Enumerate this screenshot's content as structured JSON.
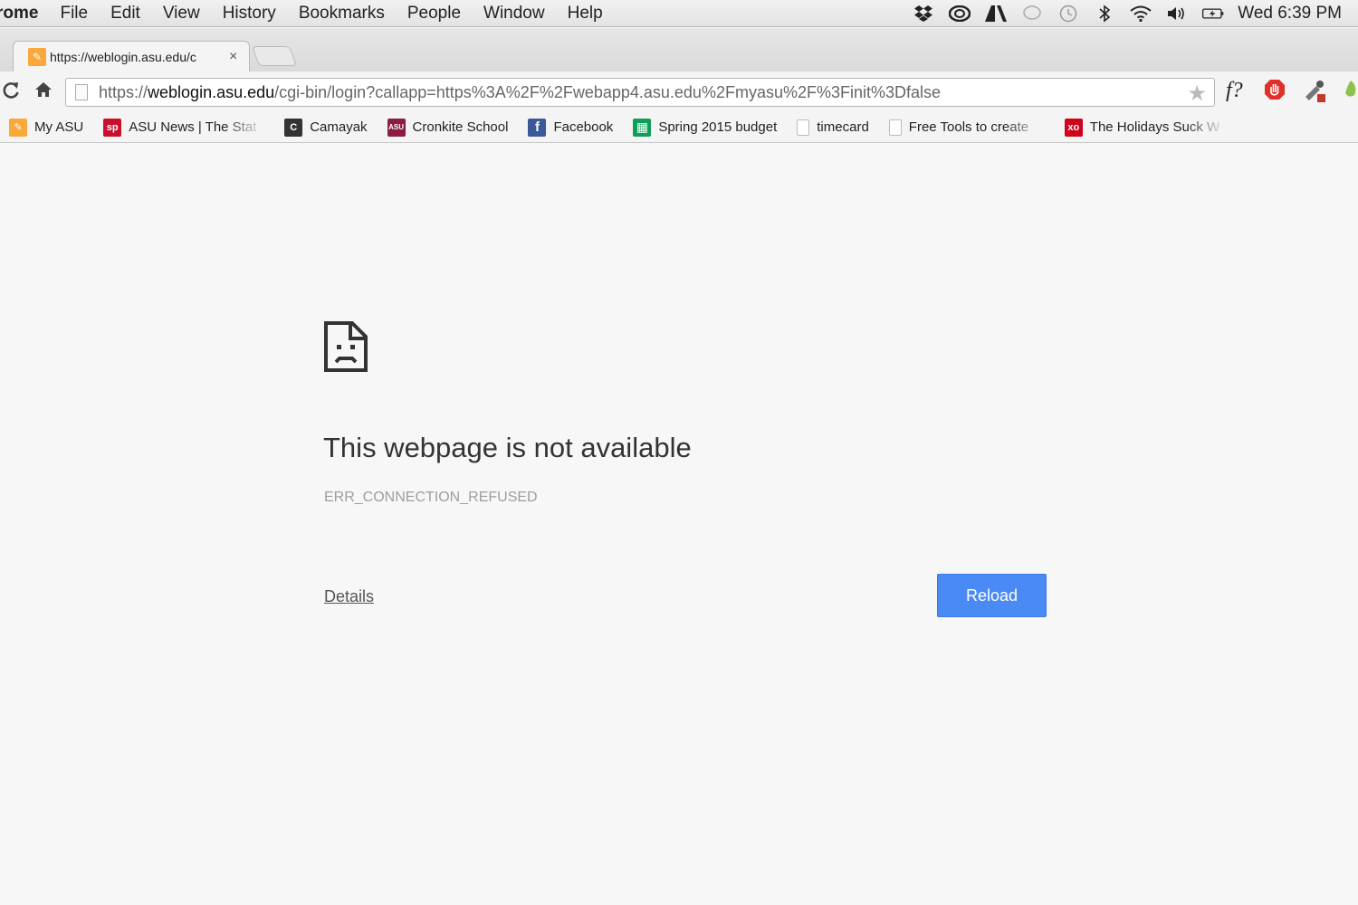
{
  "menubar": {
    "app_name": "rome",
    "menus": [
      "File",
      "Edit",
      "View",
      "History",
      "Bookmarks",
      "People",
      "Window",
      "Help"
    ],
    "clock": "Wed 6:39 PM"
  },
  "tab": {
    "title": "https://weblogin.asu.edu/c",
    "close_glyph": "×"
  },
  "omnibox": {
    "url_prefix": "https://",
    "url_host": "weblogin.asu.edu",
    "url_path": "/cgi-bin/login?callapp=https%3A%2F%2Fwebapp4.asu.edu%2Fmyasu%2F%3Finit%3Dfalse"
  },
  "extensions": {
    "fquery_label": "f?"
  },
  "bookmarks": [
    {
      "label": "My ASU",
      "icon": "asu-icon",
      "color": "#f9a83b",
      "glyph": "✎"
    },
    {
      "label": "ASU News | The Stat",
      "icon": "statepress-icon",
      "color": "#c8102e",
      "glyph": "sp"
    },
    {
      "label": "Camayak",
      "icon": "camayak-icon",
      "color": "#333333",
      "glyph": "C"
    },
    {
      "label": "Cronkite School",
      "icon": "cronkite-icon",
      "color": "#8c1d40",
      "glyph": "ASU"
    },
    {
      "label": "Facebook",
      "icon": "facebook-icon",
      "color": "#3b5998",
      "glyph": "f"
    },
    {
      "label": "Spring 2015 budget",
      "icon": "sheets-icon",
      "color": "#0f9d58",
      "glyph": "▦"
    },
    {
      "label": "timecard",
      "icon": "page-icon",
      "color": "#ffffff",
      "glyph": ""
    },
    {
      "label": "Free Tools to create",
      "icon": "page-icon",
      "color": "#ffffff",
      "glyph": ""
    },
    {
      "label": "The Holidays Suck W",
      "icon": "xojane-icon",
      "color": "#d0021b",
      "glyph": "xo"
    }
  ],
  "error_page": {
    "title": "This webpage is not available",
    "code": "ERR_CONNECTION_REFUSED",
    "details_label": "Details",
    "reload_label": "Reload",
    "accent_color": "#4a8af4"
  }
}
